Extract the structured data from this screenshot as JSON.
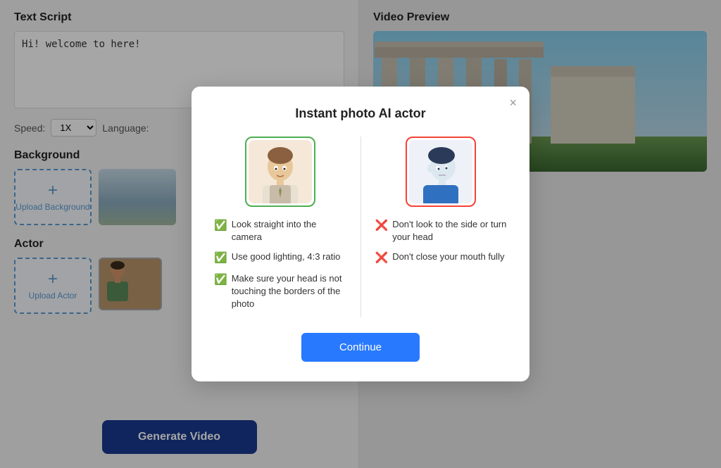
{
  "left_panel": {
    "text_script_title": "Text Script",
    "text_script_value": "Hi! welcome to here!",
    "speed_label": "Speed:",
    "speed_value": "1X",
    "language_label": "Language:",
    "background_title": "Background",
    "upload_background_label": "Upload Background",
    "actor_title": "Actor",
    "upload_actor_label": "Upload Actor",
    "generate_btn_label": "Generate Video"
  },
  "right_panel": {
    "video_preview_title": "Video Preview"
  },
  "modal": {
    "title": "Instant photo AI actor",
    "close_label": "×",
    "good_checks": [
      "Look straight into the camera",
      "Use good lighting, 4:3 ratio",
      "Make sure your head is not touching the borders of the photo"
    ],
    "bad_checks": [
      "Don't look to the side or turn your head",
      "Don't close your mouth fully"
    ],
    "continue_label": "Continue"
  }
}
